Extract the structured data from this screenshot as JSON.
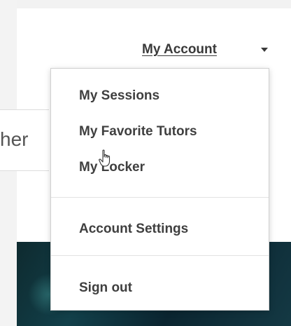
{
  "header": {
    "account_label": "My Account"
  },
  "search": {
    "partial_text": "her"
  },
  "account_menu": {
    "items": [
      {
        "label": "My Sessions"
      },
      {
        "label": "My Favorite Tutors"
      },
      {
        "label": "My Locker"
      },
      {
        "label": "Account Settings"
      },
      {
        "label": "Sign out"
      }
    ]
  },
  "icons": {
    "dropdown_caret": "caret-down-icon",
    "mouse_pointer": "hand-cursor-icon"
  },
  "colors": {
    "text": "#3f3f3f",
    "menu_border": "#d0d0d0",
    "hero_dark": "#0e2a2f"
  }
}
